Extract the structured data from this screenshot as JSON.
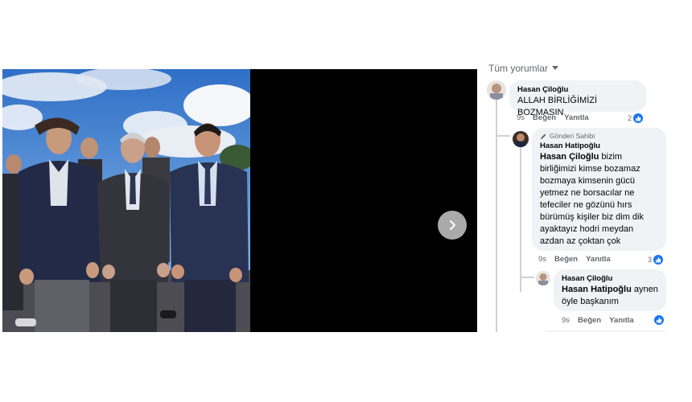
{
  "viewer": {
    "next_icon": "chevron-right-icon"
  },
  "comments_header": {
    "label": "Tüm yorumlar",
    "icon": "caret-down-icon"
  },
  "comments": [
    {
      "author": "Hasan Çiloğlu",
      "text": "ALLAH BİRLİĞİMİZİ BOZMASIN",
      "time": "9s",
      "like_label": "Beğen",
      "reply_label": "Yanıtla",
      "reaction_count": "2"
    },
    {
      "owner_badge": "Gönderi Sahibi",
      "author": "Hasan Hatipoğlu",
      "mention": "Hasan Çiloğlu",
      "text": " bizim birliğimizi kimse bozamaz bozmaya kimsenin gücü yetmez ne borsacılar ne tefeciler ne gözünü hırs bürümüş kişiler biz dim dik ayaktayız hodri meydan azdan az çoktan çok",
      "time": "9s",
      "like_label": "Beğen",
      "reply_label": "Yanıtla",
      "reaction_count": "3"
    },
    {
      "author": "Hasan Çiloğlu",
      "mention": "Hasan Hatipoğlu",
      "text": " aynen öyle başkanım",
      "time": "9s",
      "like_label": "Beğen",
      "reply_label": "Yanıtla",
      "reaction_count": ""
    }
  ],
  "colors": {
    "like_blue": "#1877f2",
    "bubble": "#f0f2f5",
    "meta_text": "#65676b"
  }
}
